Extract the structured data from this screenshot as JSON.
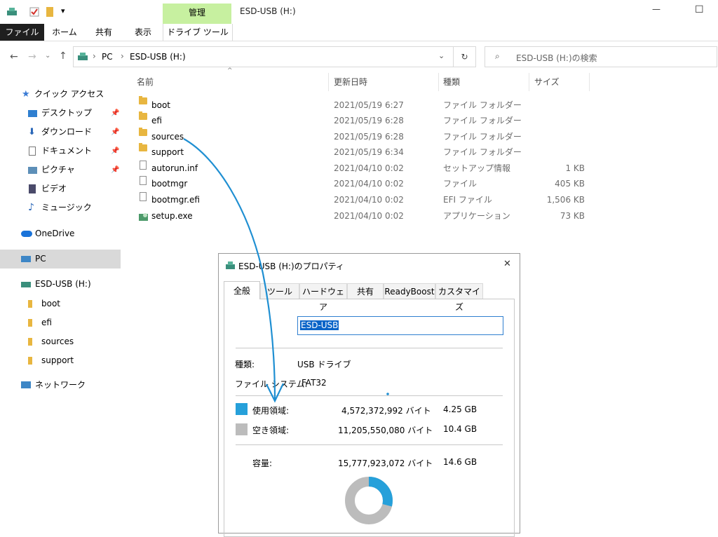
{
  "window": {
    "title": "ESD-USB (H:)",
    "minimize": "—",
    "maximize": "☐"
  },
  "ribbon": {
    "manage": "管理",
    "tabs": [
      "ファイル",
      "ホーム",
      "共有",
      "表示",
      "ドライブ ツール"
    ]
  },
  "address": {
    "path": [
      "PC",
      "ESD-USB (H:)"
    ],
    "search_placeholder": "ESD-USB (H:)の検索"
  },
  "nav": {
    "quick_access": "クイック アクセス",
    "items": [
      {
        "label": "デスクトップ",
        "pinned": true
      },
      {
        "label": "ダウンロード",
        "pinned": true
      },
      {
        "label": "ドキュメント",
        "pinned": true
      },
      {
        "label": "ピクチャ",
        "pinned": true
      },
      {
        "label": "ビデオ",
        "pinned": false
      },
      {
        "label": "ミュージック",
        "pinned": false
      }
    ],
    "onedrive": "OneDrive",
    "pc": "PC",
    "drive": "ESD-USB (H:)",
    "drive_children": [
      "boot",
      "efi",
      "sources",
      "support"
    ],
    "network": "ネットワーク"
  },
  "columns": {
    "name": "名前",
    "date": "更新日時",
    "type": "種類",
    "size": "サイズ"
  },
  "files": [
    {
      "name": "boot",
      "date": "2021/05/19 6:27",
      "type": "ファイル フォルダー",
      "size": "",
      "kind": "folder"
    },
    {
      "name": "efi",
      "date": "2021/05/19 6:28",
      "type": "ファイル フォルダー",
      "size": "",
      "kind": "folder"
    },
    {
      "name": "sources",
      "date": "2021/05/19 6:28",
      "type": "ファイル フォルダー",
      "size": "",
      "kind": "folder"
    },
    {
      "name": "support",
      "date": "2021/05/19 6:34",
      "type": "ファイル フォルダー",
      "size": "",
      "kind": "folder"
    },
    {
      "name": "autorun.inf",
      "date": "2021/04/10 0:02",
      "type": "セットアップ情報",
      "size": "1 KB",
      "kind": "file"
    },
    {
      "name": "bootmgr",
      "date": "2021/04/10 0:02",
      "type": "ファイル",
      "size": "405 KB",
      "kind": "file"
    },
    {
      "name": "bootmgr.efi",
      "date": "2021/04/10 0:02",
      "type": "EFI ファイル",
      "size": "1,506 KB",
      "kind": "file"
    },
    {
      "name": "setup.exe",
      "date": "2021/04/10 0:02",
      "type": "アプリケーション",
      "size": "73 KB",
      "kind": "exe"
    }
  ],
  "dialog": {
    "title": "ESD-USB (H:)のプロパティ",
    "close": "✕",
    "tabs": [
      "全般",
      "ツール",
      "ハードウェア",
      "共有",
      "ReadyBoost",
      "カスタマイズ"
    ],
    "name_value": "ESD-USB",
    "type_label": "種類:",
    "type_value": "USB ドライブ",
    "fs_label": "ファイル システム:",
    "fs_value": "FAT32",
    "used_label": "使用領域:",
    "used_bytes": "4,572,372,992 バイト",
    "used_gb": "4.25 GB",
    "free_label": "空き領域:",
    "free_bytes": "11,205,550,080 バイト",
    "free_gb": "10.4 GB",
    "cap_label": "容量:",
    "cap_bytes": "15,777,923,072 バイト",
    "cap_gb": "14.6 GB",
    "used_fraction": 0.29,
    "used_color": "#26a0da",
    "free_color": "#bcbcbc"
  }
}
